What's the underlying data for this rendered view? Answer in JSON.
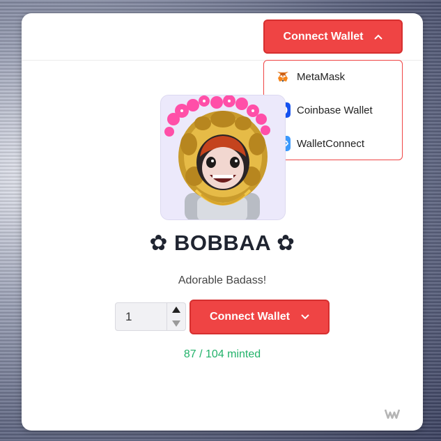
{
  "header": {
    "connect_label": "Connect Wallet"
  },
  "wallet_menu": {
    "items": [
      {
        "label": "MetaMask",
        "icon": "metamask-icon"
      },
      {
        "label": "Coinbase Wallet",
        "icon": "coinbase-icon"
      },
      {
        "label": "WalletConnect",
        "icon": "walletconnect-icon"
      }
    ]
  },
  "collection": {
    "name": "✿ BOBBAA ✿",
    "description": "Adorable Badass!"
  },
  "mint": {
    "quantity": "1",
    "connect_label": "Connect Wallet",
    "minted_text": "87 / 104 minted"
  },
  "colors": {
    "accent": "#ef4444",
    "minted": "#22b26a"
  }
}
